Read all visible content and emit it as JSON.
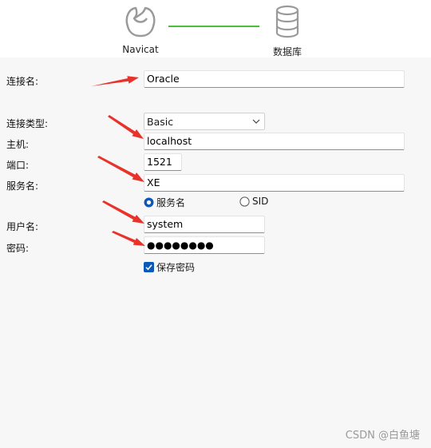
{
  "steps": {
    "step1_label": "Navicat",
    "step2_label": "数据库",
    "connector_color": "#4bbf3c",
    "step1_icon": "navicat-logo-icon",
    "step2_icon": "database-icon"
  },
  "form": {
    "connection_name": {
      "label": "连接名:",
      "value": "Oracle"
    },
    "connection_type": {
      "label": "连接类型:",
      "value": "Basic"
    },
    "host": {
      "label": "主机:",
      "value": "localhost"
    },
    "port": {
      "label": "端口:",
      "value": "1521"
    },
    "service_name": {
      "label": "服务名:",
      "value": "XE"
    },
    "service_mode": {
      "options": [
        "服务名",
        "SID"
      ],
      "selected": "服务名"
    },
    "username": {
      "label": "用户名:",
      "value": "system"
    },
    "password": {
      "label": "密码:",
      "value": "●●●●●●●●"
    },
    "save_password": {
      "label": "保存密码",
      "checked": true
    }
  },
  "watermark": "CSDN @白鱼塘",
  "colors": {
    "arrow": "#e8322a",
    "accent": "#0a58b8"
  }
}
